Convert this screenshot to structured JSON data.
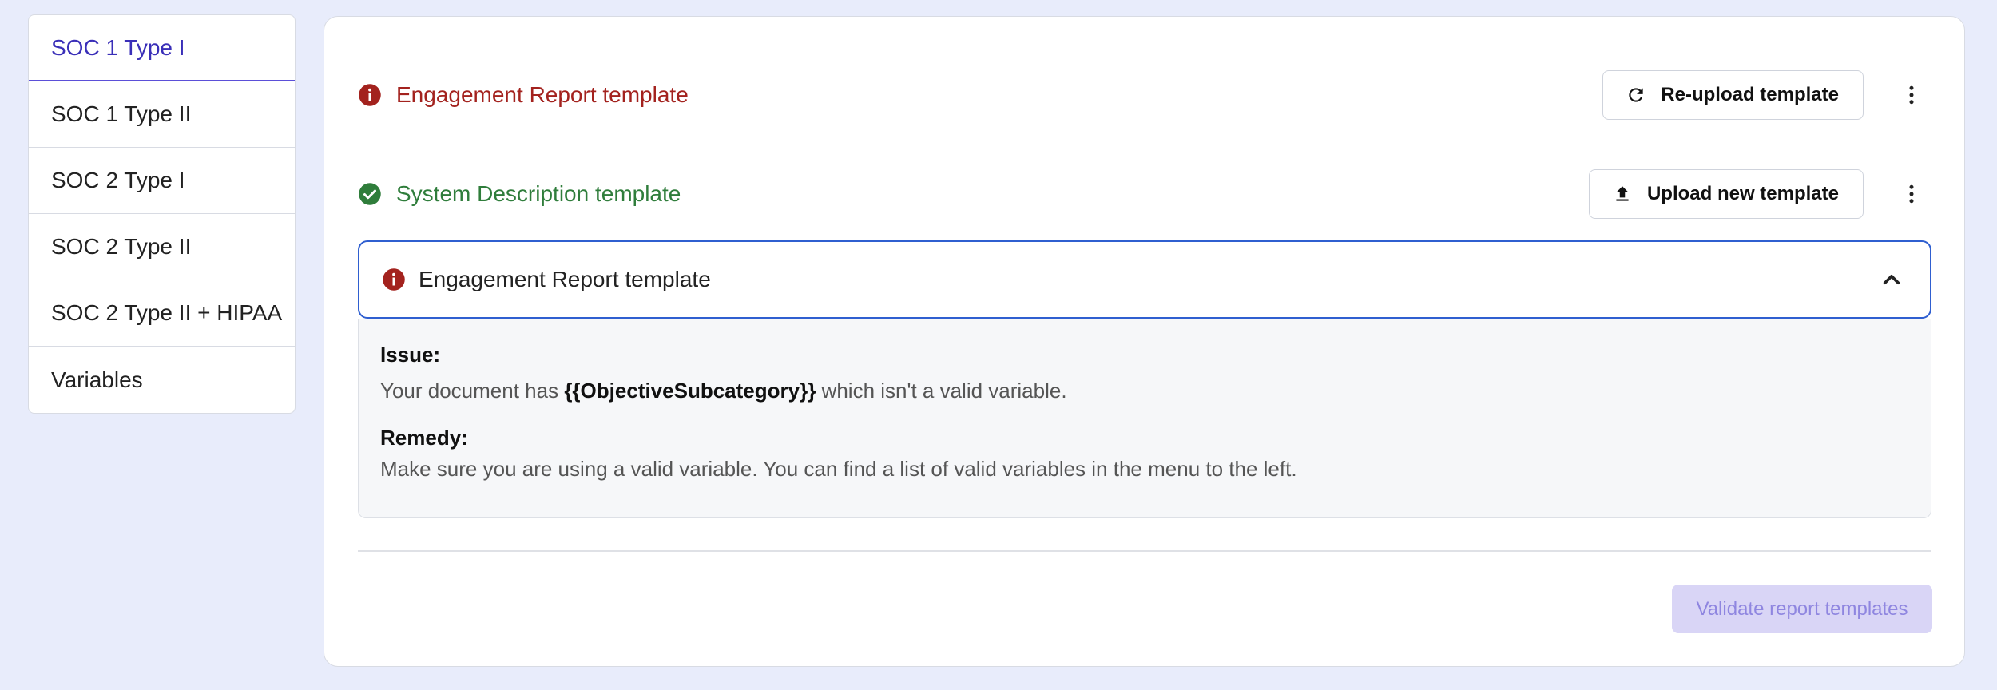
{
  "sidebar": {
    "items": [
      {
        "label": "SOC 1 Type I"
      },
      {
        "label": "SOC 1 Type II"
      },
      {
        "label": "SOC 2 Type I"
      },
      {
        "label": "SOC 2 Type II"
      },
      {
        "label": "SOC 2 Type II + HIPAA"
      },
      {
        "label": "Variables"
      }
    ],
    "active_index": 0
  },
  "templates": [
    {
      "title": "Engagement Report template",
      "status": "error",
      "status_icon": "error-icon",
      "action_label": "Re-upload template",
      "action_icon": "refresh-icon"
    },
    {
      "title": "System Description template",
      "status": "success",
      "status_icon": "check-circle-icon",
      "action_label": "Upload new template",
      "action_icon": "upload-icon"
    }
  ],
  "accordion": {
    "title": "Engagement Report template",
    "issue_label": "Issue:",
    "issue_prefix": "Your document has ",
    "issue_variable": "{{ObjectiveSubcategory}}",
    "issue_suffix": " which isn't a valid variable.",
    "remedy_label": "Remedy:",
    "remedy_text": "Make sure you are using a valid variable. You can find a list of valid variables in the menu to the left."
  },
  "footer": {
    "validate_label": "Validate report templates"
  },
  "colors": {
    "accent": "#3a2fb8",
    "error": "#a3221e",
    "success": "#2f7d3b",
    "focus_border": "#2f5fd0",
    "disabled_button_bg": "#d9d5f6"
  }
}
